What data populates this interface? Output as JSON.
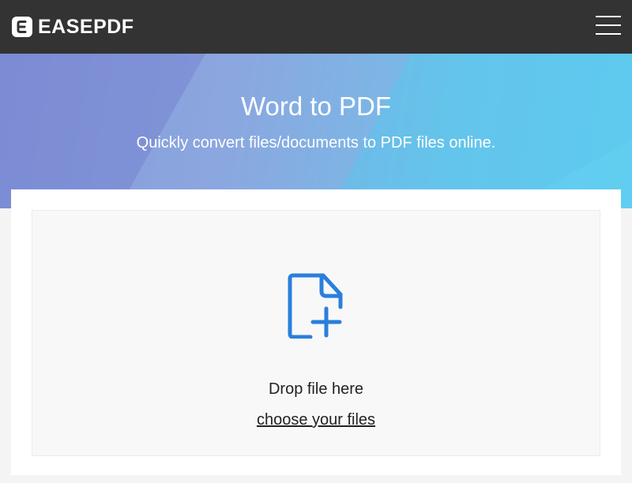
{
  "header": {
    "brand": "EASEPDF",
    "logo_icon": "easepdf-logo-icon",
    "menu_icon": "hamburger-menu-icon",
    "background_color": "#333333"
  },
  "hero": {
    "title": "Word to PDF",
    "subtitle": "Quickly convert files/documents to PDF files online.",
    "gradient_start": "#7d8fd6",
    "gradient_end": "#5fcdf0"
  },
  "upload": {
    "icon": "file-add-icon",
    "icon_color": "#2a7fdc",
    "drop_text": "Drop file here",
    "choose_text": "choose your files"
  }
}
